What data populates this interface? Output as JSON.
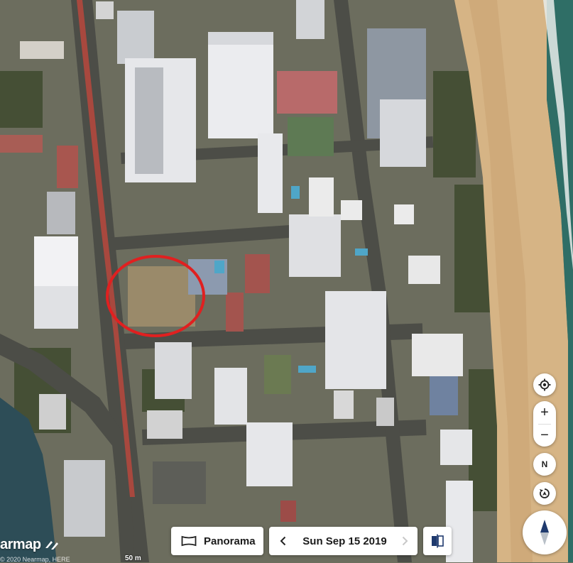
{
  "map": {
    "view": "aerial",
    "highlight_color": "#e02020"
  },
  "controls": {
    "locate_icon": "crosshair-icon",
    "zoom_in_label": "+",
    "zoom_out_label": "−",
    "north_label": "N",
    "rotate_icon": "rotate-icon",
    "compass_icon": "compass-icon"
  },
  "bottom_bar": {
    "panorama_label": "Panorama",
    "panorama_icon": "panorama-frame-icon",
    "date_label": "Sun Sep 15 2019",
    "prev_icon": "chevron-left-icon",
    "next_icon": "chevron-right-icon",
    "compare_icon": "split-compare-icon"
  },
  "attribution": {
    "logo_text": "armap",
    "copyright_text": "© 2020 Nearmap, HERE",
    "scale_text": "50 m"
  },
  "colors": {
    "ocean": "#2f6e66",
    "sand": "#d8b88c",
    "river": "#2e4e58",
    "accent_red": "#e02020"
  }
}
